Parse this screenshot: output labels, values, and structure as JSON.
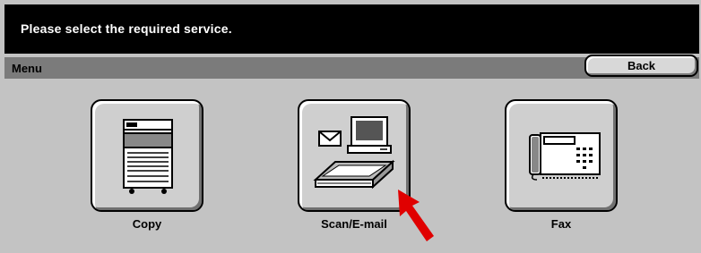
{
  "header": {
    "message": "Please select the required service."
  },
  "menubar": {
    "title": "Menu",
    "back_label": "Back"
  },
  "services": [
    {
      "label": "Copy",
      "icon": "copier-icon"
    },
    {
      "label": "Scan/E-mail",
      "icon": "scanner-email-icon"
    },
    {
      "label": "Fax",
      "icon": "fax-machine-icon"
    }
  ],
  "colors": {
    "header_bg": "#000000",
    "menubar_bg": "#7b7b7b",
    "panel_bg": "#c3c3c3",
    "pointer": "#e00000"
  }
}
